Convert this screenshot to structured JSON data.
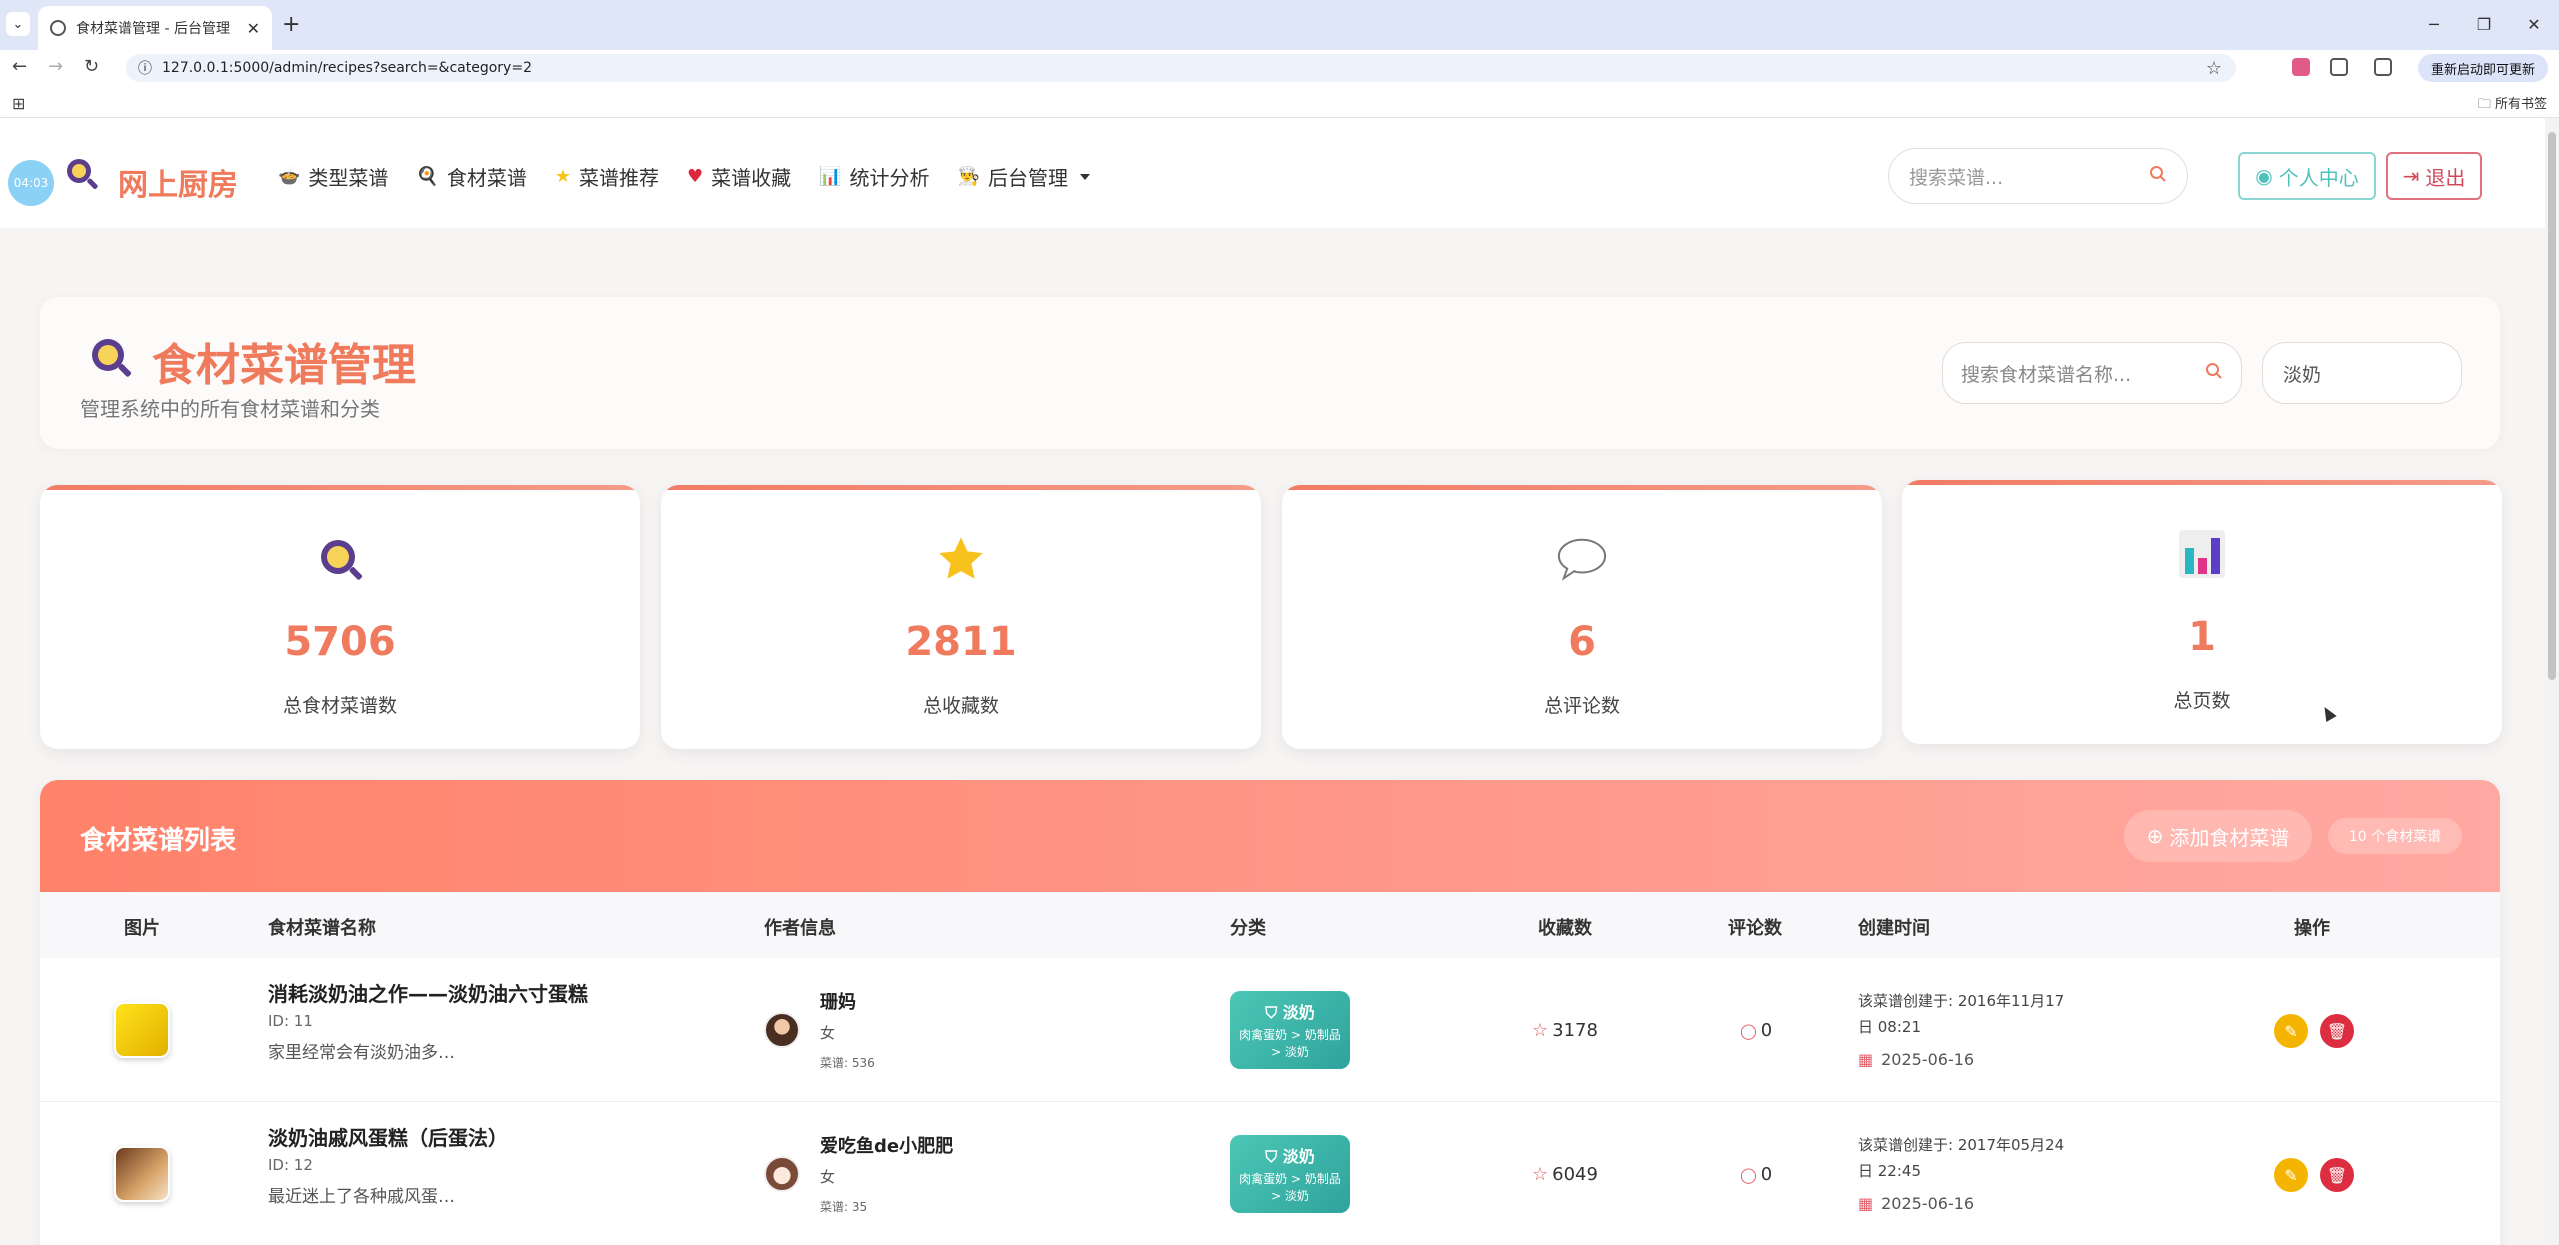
{
  "browser": {
    "tab_title": "食材菜谱管理 - 后台管理",
    "url": "127.0.0.1:5000/admin/recipes?search=&category=2",
    "update_label": "重新启动即可更新",
    "bookmarks_all": "所有书签"
  },
  "header": {
    "time": "04:03",
    "logo": "网上厨房",
    "nav": [
      {
        "label": "类型菜谱"
      },
      {
        "label": "食材菜谱"
      },
      {
        "label": "菜谱推荐"
      },
      {
        "label": "菜谱收藏"
      },
      {
        "label": "统计分析"
      },
      {
        "label": "后台管理"
      }
    ],
    "search_placeholder": "搜索菜谱...",
    "profile_label": "个人中心",
    "logout_label": "退出"
  },
  "page": {
    "title": "食材菜谱管理",
    "subtitle": "管理系统中的所有食材菜谱和分类",
    "filter_search_placeholder": "搜索食材菜谱名称...",
    "filter_category": "淡奶"
  },
  "stats": [
    {
      "value": "5706",
      "label": "总食材菜谱数"
    },
    {
      "value": "2811",
      "label": "总收藏数"
    },
    {
      "value": "6",
      "label": "总评论数"
    },
    {
      "value": "1",
      "label": "总页数"
    }
  ],
  "list": {
    "title": "食材菜谱列表",
    "add_label": "添加食材菜谱",
    "count_badge": "10 个食材菜谱",
    "columns": [
      "图片",
      "食材菜谱名称",
      "作者信息",
      "分类",
      "收藏数",
      "评论数",
      "创建时间",
      "操作"
    ],
    "rows": [
      {
        "name": "消耗淡奶油之作——淡奶油六寸蛋糕",
        "id": "ID: 11",
        "desc": "家里经常会有淡奶油多…",
        "author": "珊妈",
        "gender": "女",
        "recipe_count": "菜谱: 536",
        "category": "淡奶",
        "category_path": "肉禽蛋奶 > 奶制品 > 淡奶",
        "favorites": "3178",
        "comments": "0",
        "created_text": "该菜谱创建于: 2016年11月17日 08:21",
        "date": "2025-06-16"
      },
      {
        "name": "淡奶油戚风蛋糕（后蛋法）",
        "id": "ID: 12",
        "desc": "最近迷上了各种戚风蛋…",
        "author": "爱吃鱼de小肥肥",
        "gender": "女",
        "recipe_count": "菜谱: 35",
        "category": "淡奶",
        "category_path": "肉禽蛋奶 > 奶制品 > 淡奶",
        "favorites": "6049",
        "comments": "0",
        "created_text": "该菜谱创建于: 2017年05月24日 22:45",
        "date": "2025-06-16"
      }
    ]
  },
  "colors": {
    "accent": "#f07a5c",
    "teal": "#3fb5aa",
    "danger": "#dc2e40",
    "warning": "#f5b400"
  }
}
